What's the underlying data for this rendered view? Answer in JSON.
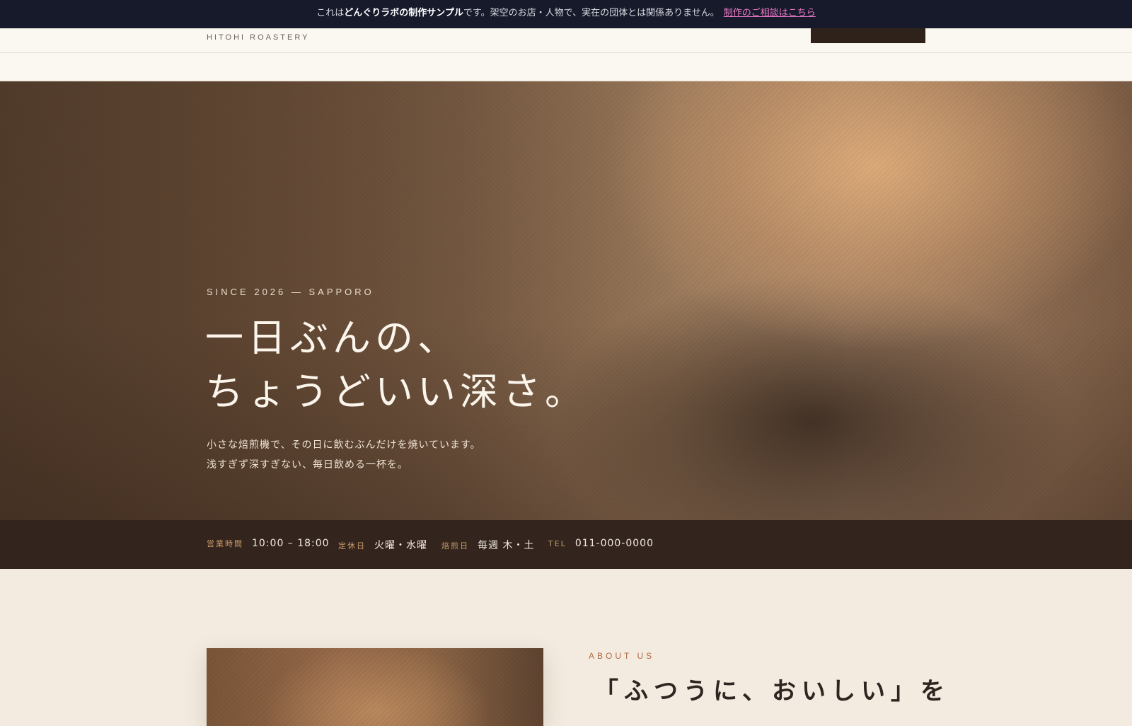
{
  "notice": {
    "prefix": "これは",
    "brand": "どんぐりラボの制作サンプル",
    "suffix": "です。架空のお店・人物で、実在の団体とは関係ありません。",
    "link_label": "制作のご相談はこちら"
  },
  "header": {
    "brand_sub": "HITOHI ROASTERY"
  },
  "hero": {
    "eyebrow": "SINCE 2026 — SAPPORO",
    "title_line1": "一日ぶんの、",
    "title_line2": "ちょうどいい深さ。",
    "lead_line1": "小さな焙煎機で、その日に飲むぶんだけを焼いています。",
    "lead_line2": "浅すぎず深すぎない、毎日飲める一杯を。"
  },
  "info": {
    "hours_label": "営業時間",
    "hours_value": "10:00 – 18:00",
    "closed_label": "定休日",
    "closed_value": "火曜・水曜",
    "roast_label": "焙煎日",
    "roast_value": "毎週 木・土",
    "tel_label": "TEL",
    "tel_value": "011-000-0000"
  },
  "about": {
    "eyebrow": "ABOUT US",
    "heading": "「ふつうに、おいしい」を"
  }
}
